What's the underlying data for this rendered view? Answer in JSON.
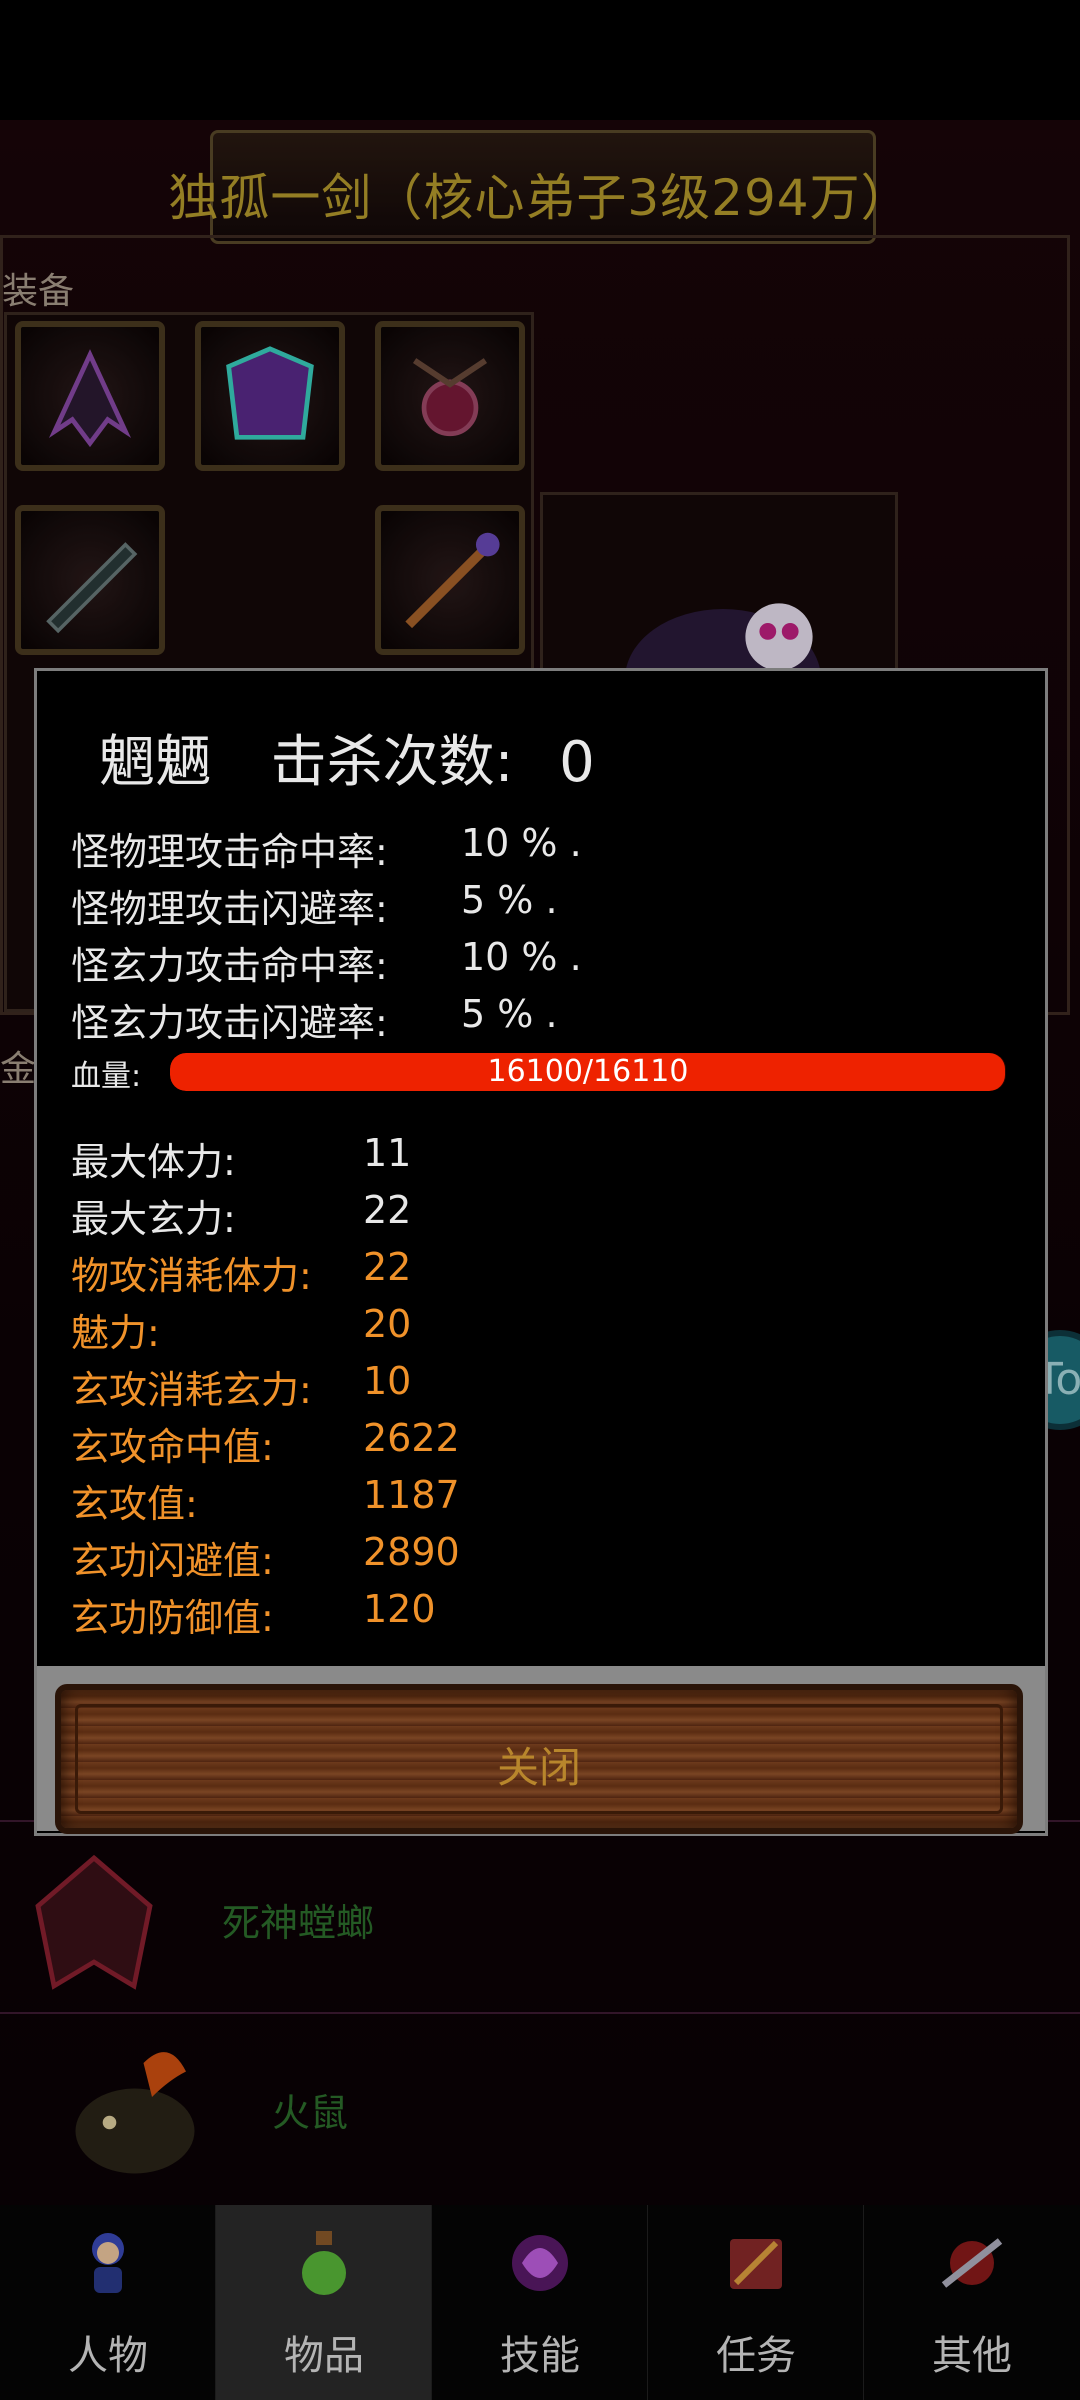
{
  "header": {
    "title": "独孤一剑（核心弟子3级294万）"
  },
  "equipment": {
    "label": "装备"
  },
  "gold": {
    "label": "金币"
  },
  "monster_list": [
    {
      "name": "死神螳螂"
    },
    {
      "name": "火鼠"
    }
  ],
  "side_button": {
    "label": "To"
  },
  "modal": {
    "name": "魍魉",
    "kill_label": "击杀次数:",
    "kill_count": "0",
    "rates": [
      {
        "label": "怪物理攻击命中率:",
        "value": "10 % ."
      },
      {
        "label": "怪物理攻击闪避率:",
        "value": "5 % ."
      },
      {
        "label": "怪玄力攻击命中率:",
        "value": "10 % ."
      },
      {
        "label": "怪玄力攻击闪避率:",
        "value": "5 % ."
      }
    ],
    "hp": {
      "label": "血量:",
      "text": "16100/16110",
      "current": 16100,
      "max": 16110
    },
    "attributes": [
      {
        "label": "最大体力:",
        "value": "11",
        "color": "white"
      },
      {
        "label": "最大玄力:",
        "value": "22",
        "color": "white"
      },
      {
        "label": "物攻消耗体力:",
        "value": "22",
        "color": "orange"
      },
      {
        "label": "魅力:",
        "value": "20",
        "color": "orange"
      },
      {
        "label": "玄攻消耗玄力:",
        "value": "10",
        "color": "orange"
      },
      {
        "label": "玄攻命中值:",
        "value": "2622",
        "color": "orange"
      },
      {
        "label": "玄攻值:",
        "value": "1187",
        "color": "orange"
      },
      {
        "label": "玄功闪避值:",
        "value": "2890",
        "color": "orange"
      },
      {
        "label": "玄功防御值:",
        "value": "120",
        "color": "orange"
      }
    ],
    "close_label": "关闭"
  },
  "nav": {
    "items": [
      {
        "label": "人物",
        "icon": "character-icon"
      },
      {
        "label": "物品",
        "icon": "potion-icon",
        "active": true
      },
      {
        "label": "技能",
        "icon": "skill-icon"
      },
      {
        "label": "任务",
        "icon": "quest-icon"
      },
      {
        "label": "其他",
        "icon": "other-icon"
      }
    ]
  },
  "colors": {
    "accent_orange": "#f0922a",
    "hp_red": "#ee2200",
    "title_gold": "#b59a2c"
  }
}
